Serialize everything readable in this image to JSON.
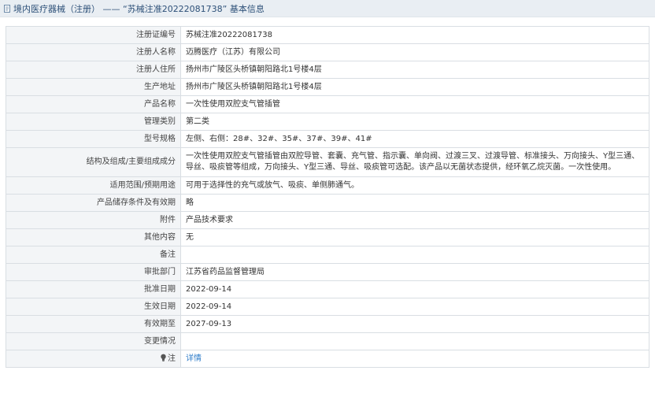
{
  "header": {
    "title": "境内医疗器械（注册） —— “苏械注准20222081738” 基本信息",
    "icon": "document-icon"
  },
  "rows": [
    {
      "label": "注册证编号",
      "value": "苏械注准20222081738"
    },
    {
      "label": "注册人名称",
      "value": "迈腾医疗（江苏）有限公司"
    },
    {
      "label": "注册人住所",
      "value": "扬州市广陵区头桥镇朝阳路北1号楼4层"
    },
    {
      "label": "生产地址",
      "value": "扬州市广陵区头桥镇朝阳路北1号楼4层"
    },
    {
      "label": "产品名称",
      "value": "一次性使用双腔支气管插管"
    },
    {
      "label": "管理类别",
      "value": "第二类"
    },
    {
      "label": "型号规格",
      "value": "左侧、右侧：28#、32#、35#、37#、39#、41#"
    },
    {
      "label": "结构及组成/主要组成成分",
      "value": "一次性使用双腔支气管插管由双腔导管、套囊、充气管、指示囊、单向阀、过渡三叉、过渡导管、标准接头、万向接头、Y型三通、导丝、吸痰管等组成，万向接头、Y型三通、导丝、吸痰管可选配。该产品以无菌状态提供，经环氧乙烷灭菌。一次性使用。"
    },
    {
      "label": "适用范围/预期用途",
      "value": "可用于选择性的充气或放气、吸痰、单侧肺通气。"
    },
    {
      "label": "产品储存条件及有效期",
      "value": "略"
    },
    {
      "label": "附件",
      "value": "产品技术要求"
    },
    {
      "label": "其他内容",
      "value": "无"
    },
    {
      "label": "备注",
      "value": ""
    },
    {
      "label": "审批部门",
      "value": "江苏省药品监督管理局"
    },
    {
      "label": "批准日期",
      "value": "2022-09-14"
    },
    {
      "label": "生效日期",
      "value": "2022-09-14"
    },
    {
      "label": "有效期至",
      "value": "2027-09-13"
    },
    {
      "label": "变更情况",
      "value": ""
    }
  ],
  "note_row": {
    "label": "注",
    "label_icon": "lightbulb-icon",
    "link_text": "详情",
    "link_color": "#2e7cc9"
  },
  "colors": {
    "header_bg": "#e9eef3",
    "header_text": "#2d5078",
    "label_bg": "#f3f5f7",
    "border": "#d9dee3"
  }
}
